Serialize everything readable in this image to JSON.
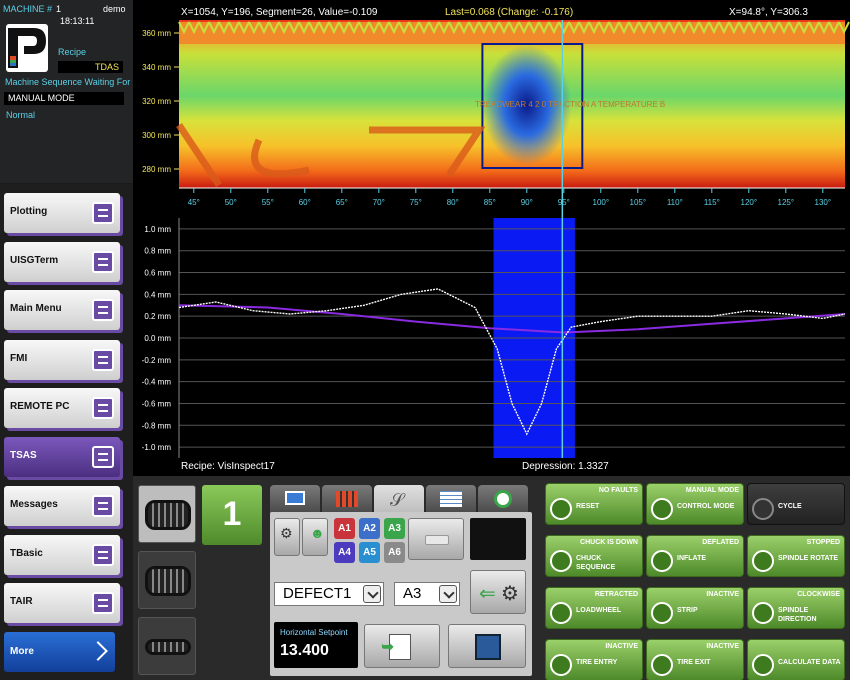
{
  "header": {
    "machine_label": "MACHINE #",
    "machine_num": "1",
    "user": "demo",
    "time": "18:13:11",
    "recipe_label": "Recipe",
    "recipe_value": "TDAS",
    "sequence_label": "Machine Sequence Waiting For",
    "mode_value": "MANUAL MODE",
    "status": "Normal"
  },
  "nav": {
    "items": [
      "Plotting",
      "UISGTerm",
      "Main Menu",
      "FMI",
      "REMOTE PC",
      "TSAS",
      "Messages",
      "TBasic",
      "TAIR"
    ],
    "selected": "TSAS",
    "more": "More"
  },
  "plot": {
    "readout_left": "X=1054, Y=196, Segment=26, Value=-0.109",
    "readout_mid": "Last=0.068  (Change: -0.176)",
    "readout_right": "X=94.8°, Y=306.3",
    "heat_y_ticks": [
      "360 mm",
      "340 mm",
      "320 mm",
      "300 mm",
      "280 mm"
    ],
    "x_ticks": [
      "45°",
      "50°",
      "55°",
      "60°",
      "65°",
      "70°",
      "75°",
      "80°",
      "85°",
      "90°",
      "95°",
      "100°",
      "105°",
      "110°",
      "115°",
      "120°",
      "125°",
      "130°"
    ],
    "profile_y_ticks": [
      "1.0 mm",
      "0.8 mm",
      "0.6 mm",
      "0.4 mm",
      "0.2 mm",
      "0.0 mm",
      "-0.2 mm",
      "-0.4 mm",
      "-0.6 mm",
      "-0.8 mm",
      "-1.0 mm"
    ],
    "overlay_text": "TREADWEAR 4 2 0   TRACTION  A   TEMPERATURE  B",
    "recipe_footer": "Recipe: VisInspect17",
    "depression_footer": "Depression: 1.3327"
  },
  "chart_data": {
    "type": "line",
    "xlabel": "",
    "ylabel": "",
    "xlim": [
      43,
      133
    ],
    "ylim": [
      -1.1,
      1.1
    ],
    "series": [
      {
        "x": [
          43,
          48,
          53,
          58,
          63,
          68,
          73,
          78,
          83,
          86,
          88,
          90,
          92,
          94,
          96,
          100,
          105,
          110,
          115,
          120,
          125,
          130,
          133
        ],
        "y": [
          0.28,
          0.33,
          0.25,
          0.22,
          0.25,
          0.3,
          0.4,
          0.45,
          0.28,
          -0.1,
          -0.6,
          -0.88,
          -0.6,
          -0.1,
          0.1,
          0.15,
          0.2,
          0.2,
          0.2,
          0.25,
          0.22,
          0.18,
          0.22
        ]
      },
      {
        "x": [
          43,
          55,
          65,
          75,
          85,
          95,
          105,
          115,
          125,
          133
        ],
        "y": [
          0.3,
          0.28,
          0.22,
          0.15,
          0.09,
          0.05,
          0.08,
          0.13,
          0.18,
          0.22
        ]
      }
    ],
    "highlight_x": [
      85.5,
      96.5
    ],
    "cursor_x": 94.8
  },
  "controls": {
    "segment_number": "1",
    "defect_select": "DEFECT1",
    "area_select": "A3",
    "area_buttons": [
      "A1",
      "A2",
      "A3",
      "A4",
      "A5",
      "A6"
    ],
    "setpoint_label": "Horizontal Setpoint",
    "setpoint_value": "13.400"
  },
  "grid": [
    {
      "status": "NO FAULTS",
      "label": "RESET"
    },
    {
      "status": "MANUAL MODE",
      "label": "CONTROL MODE"
    },
    {
      "status": "",
      "label": "CYCLE"
    },
    {
      "status": "CHUCK IS DOWN",
      "label": "CHUCK SEQUENCE"
    },
    {
      "status": "DEFLATED",
      "label": "INFLATE"
    },
    {
      "status": "STOPPED",
      "label": "SPINDLE ROTATE"
    },
    {
      "status": "RETRACTED",
      "label": "LOADWHEEL"
    },
    {
      "status": "INACTIVE",
      "label": "STRIP"
    },
    {
      "status": "CLOCKWISE",
      "label": "SPINDLE DIRECTION"
    },
    {
      "status": "INACTIVE",
      "label": "TIRE ENTRY"
    },
    {
      "status": "INACTIVE",
      "label": "TIRE EXIT"
    },
    {
      "status": "",
      "label": "CALCULATE DATA"
    }
  ]
}
